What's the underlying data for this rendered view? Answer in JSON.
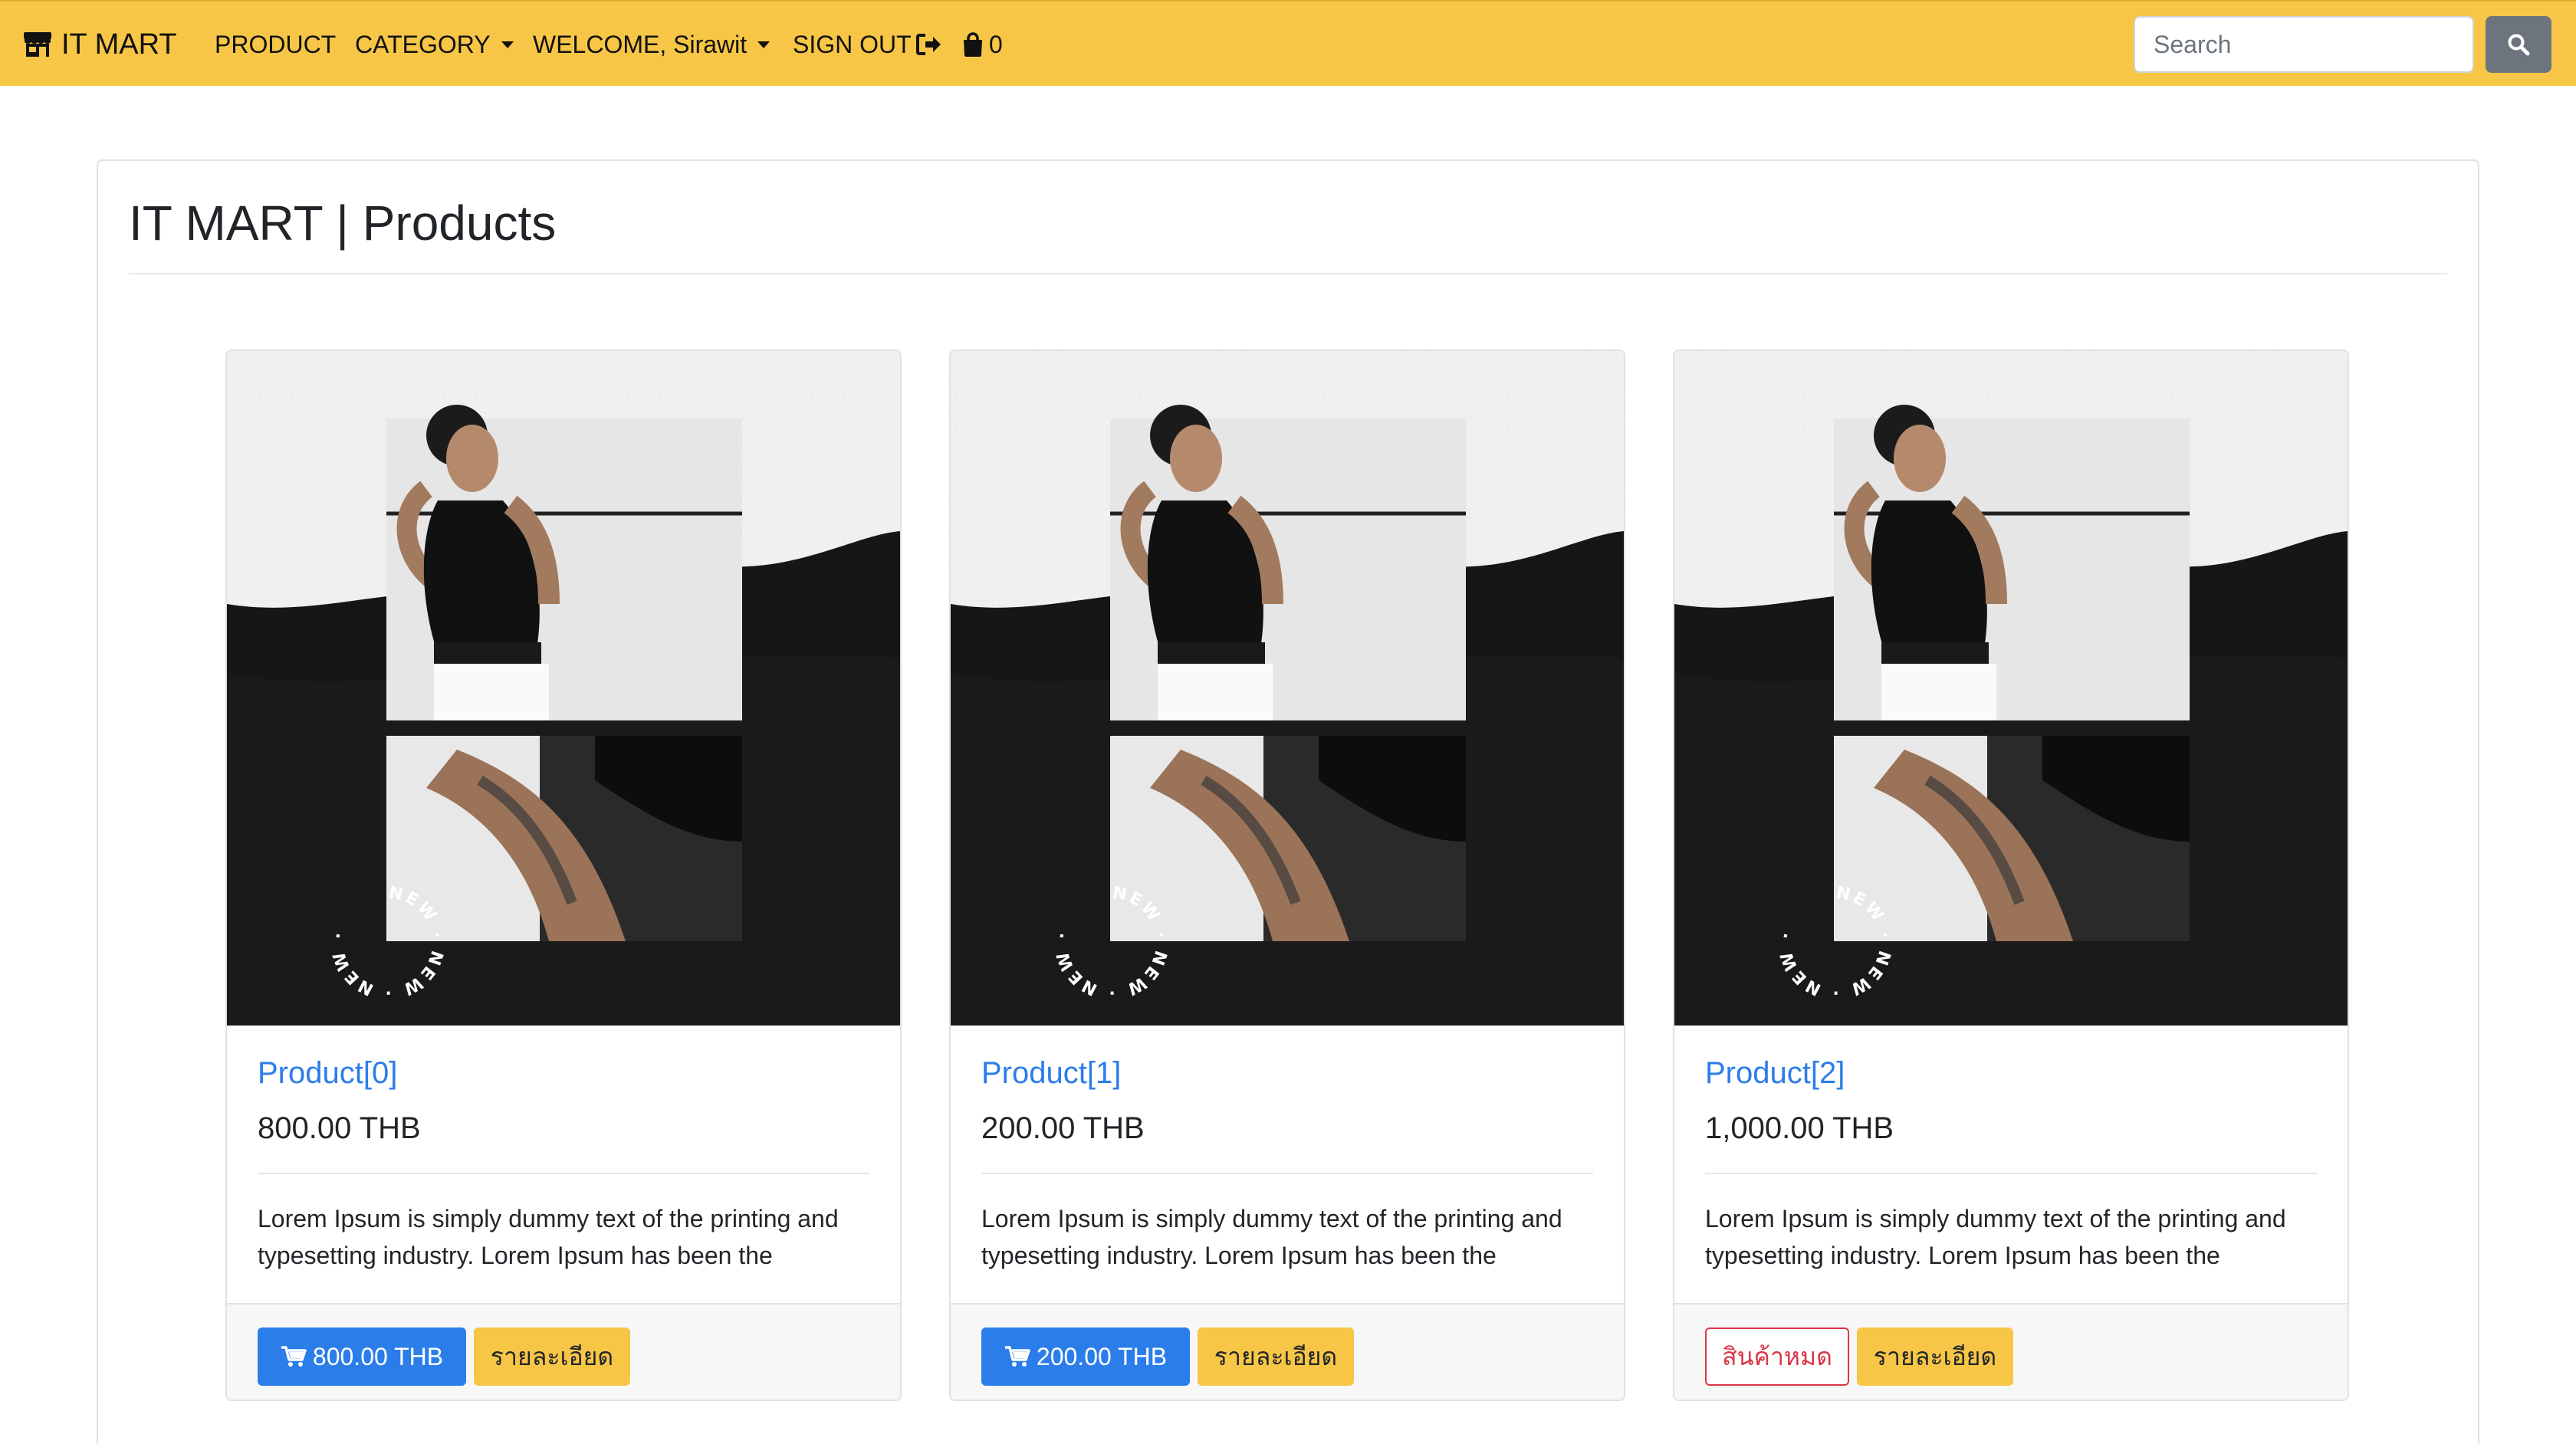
{
  "navbar": {
    "brand": "IT MART",
    "brand_icon": "store-icon",
    "items": {
      "product": "PRODUCT",
      "category": "CATEGORY",
      "welcome": "WELCOME, Sirawit",
      "signout": "SIGN OUT"
    },
    "cart_count": "0",
    "search_placeholder": "Search",
    "colors": {
      "background": "#f7c646",
      "search_button": "#6c757d"
    }
  },
  "page": {
    "title": "IT MART | Products"
  },
  "products": [
    {
      "name": "Product[0]",
      "price": "800.00 THB",
      "description": "Lorem Ipsum is simply dummy text of the printing and typesetting industry. Lorem Ipsum has been the",
      "buy_label": "800.00 THB",
      "detail_label": "รายละเอียด"
    },
    {
      "name": "Product[1]",
      "price": "200.00 THB",
      "description": "Lorem Ipsum is simply dummy text of the printing and typesetting industry. Lorem Ipsum has been the",
      "buy_label": "200.00 THB",
      "detail_label": "รายละเอียด"
    },
    {
      "name": "Product[2]",
      "price": "1,000.00 THB",
      "description": "Lorem Ipsum is simply dummy text of the printing and typesetting industry. Lorem Ipsum has been the",
      "out_of_stock_label": "สินค้าหมด",
      "detail_label": "รายละเอียด"
    }
  ],
  "image_badge_text": "NEW · NEW · NEW · ",
  "colors": {
    "link": "#2b7de9",
    "buy_button": "#2b7de9",
    "detail_button": "#f7c646",
    "out_of_stock": "#dc3545"
  }
}
